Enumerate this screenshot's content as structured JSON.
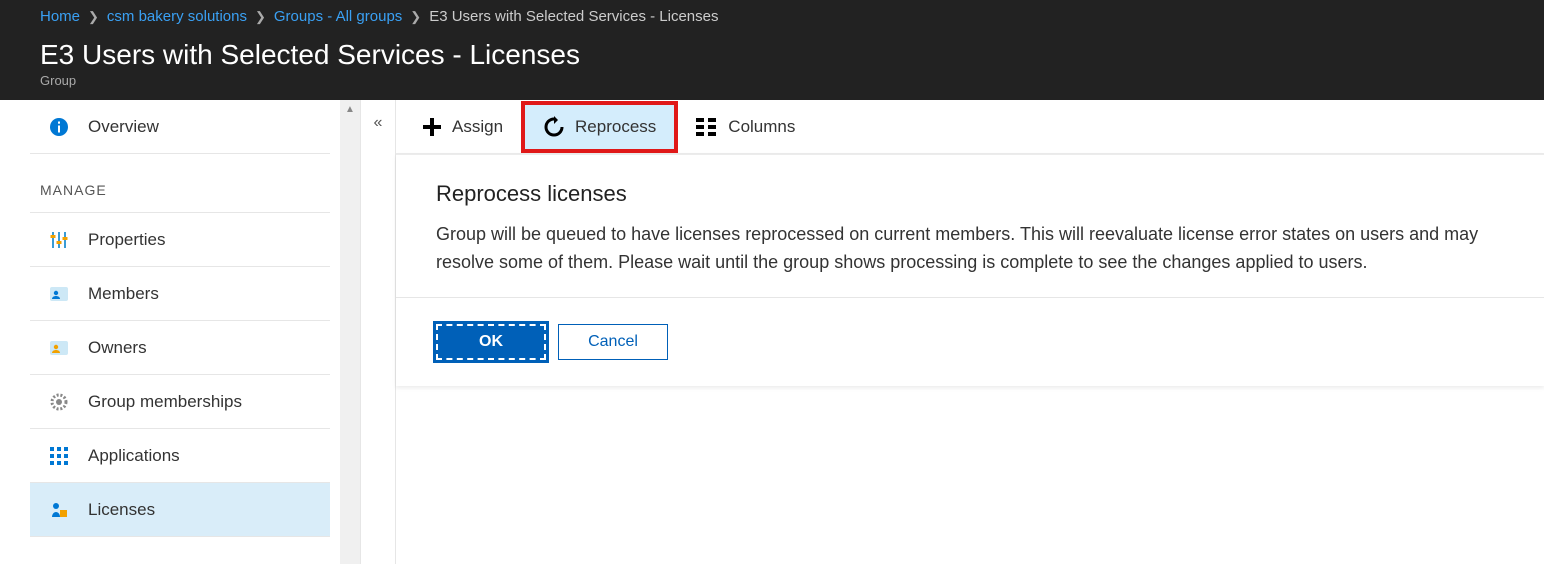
{
  "breadcrumb": {
    "home": "Home",
    "org": "csm bakery solutions",
    "groups": "Groups - All groups",
    "current": "E3 Users with Selected Services - Licenses"
  },
  "header": {
    "title": "E3 Users with Selected Services - Licenses",
    "subtitle": "Group"
  },
  "sidebar": {
    "overview": "Overview",
    "manage_label": "MANAGE",
    "items": [
      {
        "label": "Properties"
      },
      {
        "label": "Members"
      },
      {
        "label": "Owners"
      },
      {
        "label": "Group memberships"
      },
      {
        "label": "Applications"
      },
      {
        "label": "Licenses"
      }
    ]
  },
  "toolbar": {
    "assign": "Assign",
    "reprocess": "Reprocess",
    "columns": "Columns"
  },
  "panel": {
    "title": "Reprocess licenses",
    "desc": "Group will be queued to have licenses reprocessed on current members. This will reevaluate license error states on users and may resolve some of them. Please wait until the group shows processing is complete to see the changes applied to users.",
    "ok": "OK",
    "cancel": "Cancel"
  }
}
